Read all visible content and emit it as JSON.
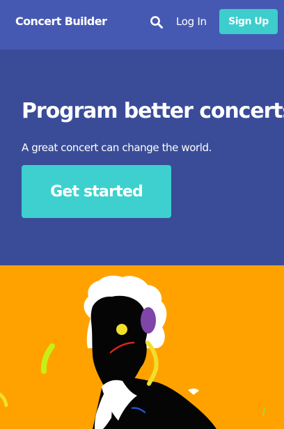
{
  "header": {
    "brand": "Concert Builder",
    "search_icon": "search-icon",
    "login_label": "Log In",
    "signup_label": "Sign Up"
  },
  "hero": {
    "title": "Program better concerts",
    "subtitle": "A great concert can change the world.",
    "cta_label": "Get started"
  },
  "colors": {
    "nav_background": "#4659b2",
    "hero_background": "#3a4c98",
    "accent": "#3dcdcd",
    "illustration_background": "#ffa200"
  }
}
